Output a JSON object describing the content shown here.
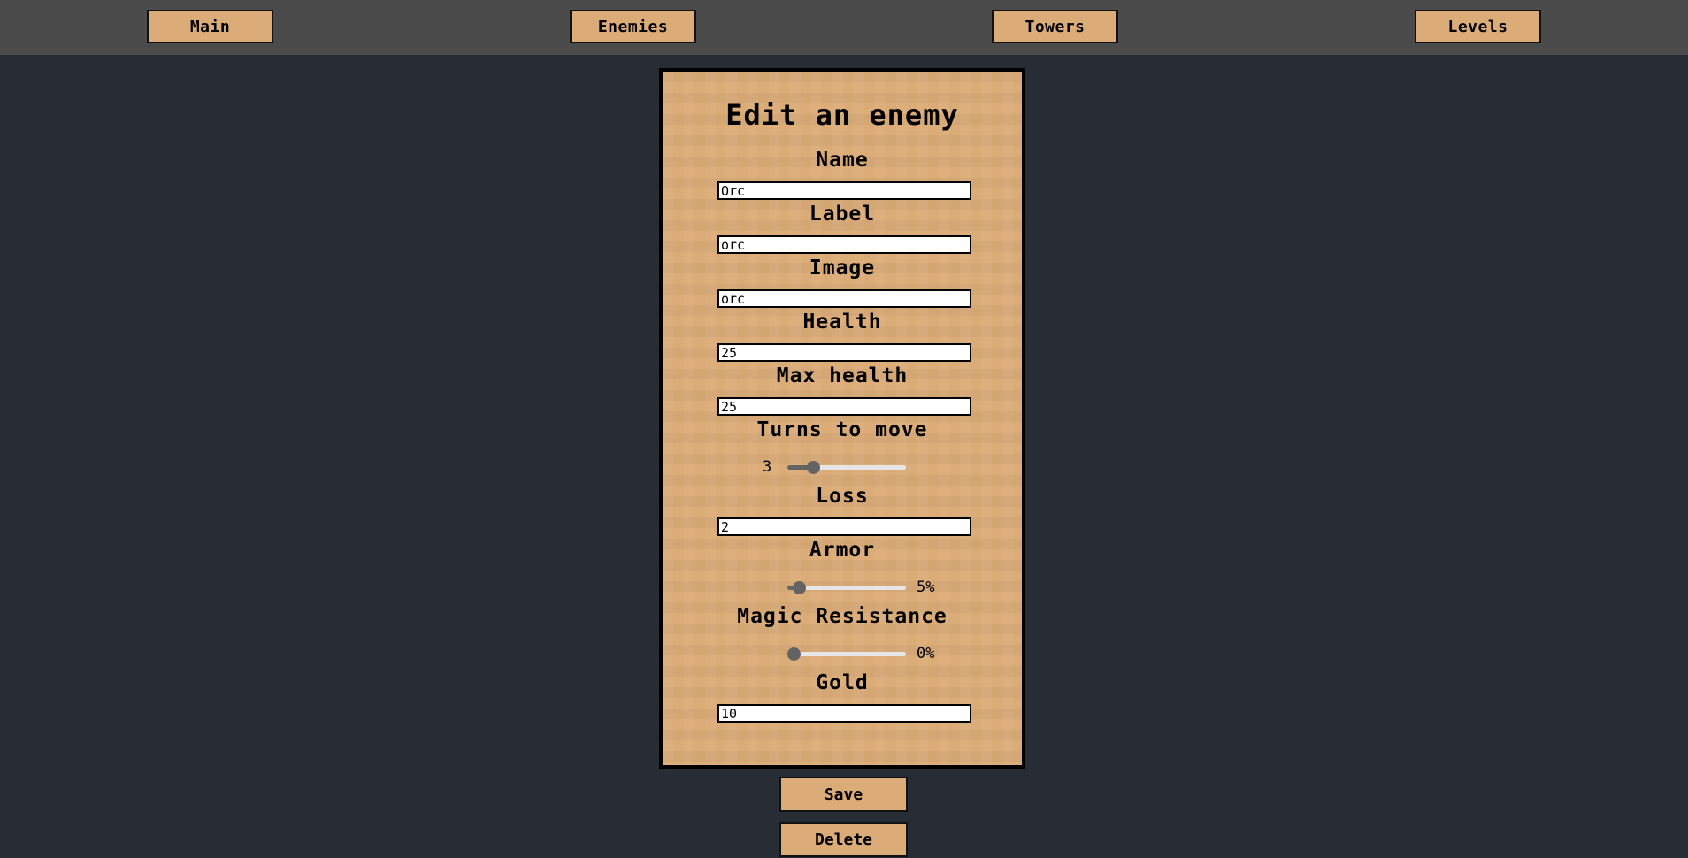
{
  "nav": {
    "main": "Main",
    "enemies": "Enemies",
    "towers": "Towers",
    "levels": "Levels"
  },
  "form": {
    "title": "Edit an enemy",
    "name_label": "Name",
    "name_value": "Orc",
    "label_label": "Label",
    "label_value": "orc",
    "image_label": "Image",
    "image_value": "orc",
    "health_label": "Health",
    "health_value": "25",
    "max_health_label": "Max health",
    "max_health_value": "25",
    "turns_label": "Turns to move",
    "turns_value": "3",
    "turns_fraction": 0.22,
    "loss_label": "Loss",
    "loss_value": "2",
    "armor_label": "Armor",
    "armor_value": "5%",
    "armor_fraction": 0.1,
    "magic_label": "Magic Resistance",
    "magic_value": "0%",
    "magic_fraction": 0.05,
    "gold_label": "Gold",
    "gold_value": "10"
  },
  "actions": {
    "save": "Save",
    "delete": "Delete"
  },
  "colors": {
    "background": "#282c35",
    "topbar": "#4b4b4b",
    "panel": "#dcac78",
    "slider": "#636363"
  }
}
